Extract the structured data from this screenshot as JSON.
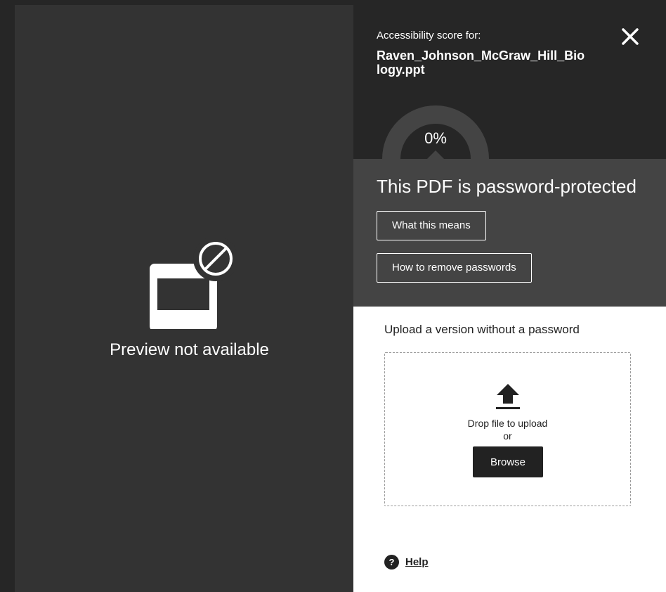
{
  "preview": {
    "icon": "preview-unavailable-icon",
    "message": "Preview not available"
  },
  "panel": {
    "score_label": "Accessibility score for:",
    "file_name": "Raven_Johnson_McGraw_Hill_Biology.ppt",
    "close_icon": "close-icon",
    "score": {
      "value": 0,
      "display": "0%"
    },
    "notice": {
      "title": "This PDF is password-protected",
      "what_button": "What this means",
      "how_button": "How to remove passwords"
    },
    "upload": {
      "label": "Upload a version without a password",
      "icon": "upload-icon",
      "drop_text": "Drop file to upload",
      "or_text": "or",
      "browse_button": "Browse"
    },
    "help": {
      "icon": "help-icon",
      "label": "Help"
    }
  },
  "colors": {
    "page_bg": "#262626",
    "preview_bg": "#333333",
    "header_bg": "#262626",
    "notice_bg": "#444444",
    "gauge_track": "#444444",
    "panel_bg": "#ffffff",
    "dark_button": "#222222"
  }
}
